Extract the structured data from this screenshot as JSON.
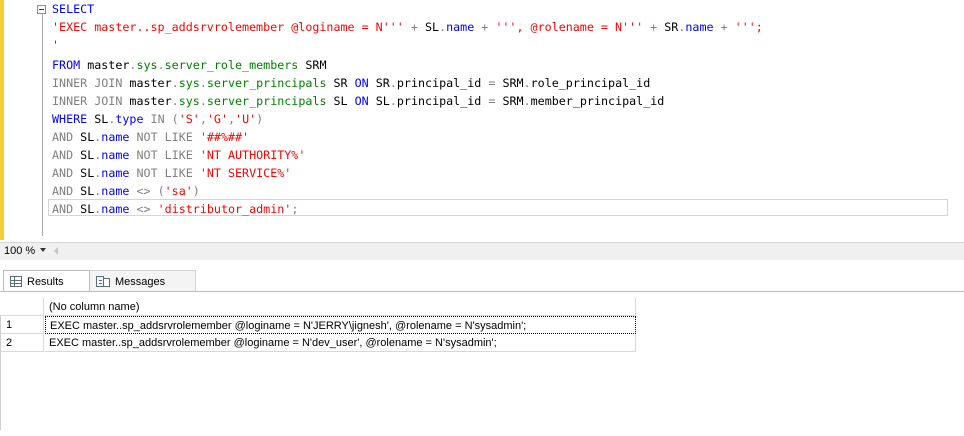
{
  "editor": {
    "lines": [
      [
        {
          "c": "kw",
          "t": "SELECT"
        }
      ],
      [
        {
          "c": "str",
          "t": "'EXEC master..sp_addsrvrolemember @loginame = N'''"
        },
        {
          "c": "op",
          "t": " + "
        },
        {
          "c": "txt",
          "t": "SL"
        },
        {
          "c": "op",
          "t": "."
        },
        {
          "c": "kw",
          "t": "name"
        },
        {
          "c": "op",
          "t": " + "
        },
        {
          "c": "str",
          "t": "''', @rolename = N'''"
        },
        {
          "c": "op",
          "t": " + "
        },
        {
          "c": "txt",
          "t": "SR"
        },
        {
          "c": "op",
          "t": "."
        },
        {
          "c": "kw",
          "t": "name"
        },
        {
          "c": "op",
          "t": " + "
        },
        {
          "c": "str",
          "t": "''';"
        }
      ],
      [
        {
          "c": "str",
          "t": "'"
        }
      ],
      [
        {
          "c": "kw",
          "t": "FROM"
        },
        {
          "c": "txt",
          "t": " master"
        },
        {
          "c": "op",
          "t": "."
        },
        {
          "c": "sys",
          "t": "sys"
        },
        {
          "c": "op",
          "t": "."
        },
        {
          "c": "sys",
          "t": "server_role_members"
        },
        {
          "c": "txt",
          "t": " SRM"
        }
      ],
      [
        {
          "c": "op",
          "t": "INNER JOIN"
        },
        {
          "c": "txt",
          "t": " master"
        },
        {
          "c": "op",
          "t": "."
        },
        {
          "c": "sys",
          "t": "sys"
        },
        {
          "c": "op",
          "t": "."
        },
        {
          "c": "sys",
          "t": "server_principals"
        },
        {
          "c": "txt",
          "t": " SR "
        },
        {
          "c": "kw",
          "t": "ON"
        },
        {
          "c": "txt",
          "t": " SR"
        },
        {
          "c": "op",
          "t": "."
        },
        {
          "c": "txt",
          "t": "principal_id "
        },
        {
          "c": "op",
          "t": "="
        },
        {
          "c": "txt",
          "t": " SRM"
        },
        {
          "c": "op",
          "t": "."
        },
        {
          "c": "txt",
          "t": "role_principal_id"
        }
      ],
      [
        {
          "c": "op",
          "t": "INNER JOIN"
        },
        {
          "c": "txt",
          "t": " master"
        },
        {
          "c": "op",
          "t": "."
        },
        {
          "c": "sys",
          "t": "sys"
        },
        {
          "c": "op",
          "t": "."
        },
        {
          "c": "sys",
          "t": "server_principals"
        },
        {
          "c": "txt",
          "t": " SL "
        },
        {
          "c": "kw",
          "t": "ON"
        },
        {
          "c": "txt",
          "t": " SL"
        },
        {
          "c": "op",
          "t": "."
        },
        {
          "c": "txt",
          "t": "principal_id "
        },
        {
          "c": "op",
          "t": "="
        },
        {
          "c": "txt",
          "t": " SRM"
        },
        {
          "c": "op",
          "t": "."
        },
        {
          "c": "txt",
          "t": "member_principal_id"
        }
      ],
      [
        {
          "c": "kw",
          "t": "WHERE"
        },
        {
          "c": "txt",
          "t": " SL"
        },
        {
          "c": "op",
          "t": "."
        },
        {
          "c": "kw",
          "t": "type"
        },
        {
          "c": "op",
          "t": " IN ("
        },
        {
          "c": "str",
          "t": "'S'"
        },
        {
          "c": "op",
          "t": ","
        },
        {
          "c": "str",
          "t": "'G'"
        },
        {
          "c": "op",
          "t": ","
        },
        {
          "c": "str",
          "t": "'U'"
        },
        {
          "c": "op",
          "t": ")"
        }
      ],
      [
        {
          "c": "op",
          "t": "AND"
        },
        {
          "c": "txt",
          "t": " SL"
        },
        {
          "c": "op",
          "t": "."
        },
        {
          "c": "kw",
          "t": "name"
        },
        {
          "c": "op",
          "t": " NOT LIKE "
        },
        {
          "c": "str",
          "t": "'##%##'"
        }
      ],
      [
        {
          "c": "op",
          "t": "AND"
        },
        {
          "c": "txt",
          "t": " SL"
        },
        {
          "c": "op",
          "t": "."
        },
        {
          "c": "kw",
          "t": "name"
        },
        {
          "c": "op",
          "t": " NOT LIKE "
        },
        {
          "c": "str",
          "t": "'NT AUTHORITY%'"
        }
      ],
      [
        {
          "c": "op",
          "t": "AND"
        },
        {
          "c": "txt",
          "t": " SL"
        },
        {
          "c": "op",
          "t": "."
        },
        {
          "c": "kw",
          "t": "name"
        },
        {
          "c": "op",
          "t": " NOT LIKE "
        },
        {
          "c": "str",
          "t": "'NT SERVICE%'"
        }
      ],
      [
        {
          "c": "op",
          "t": "AND"
        },
        {
          "c": "txt",
          "t": " SL"
        },
        {
          "c": "op",
          "t": "."
        },
        {
          "c": "kw",
          "t": "name"
        },
        {
          "c": "op",
          "t": " <> ("
        },
        {
          "c": "str",
          "t": "'sa'"
        },
        {
          "c": "op",
          "t": ")"
        }
      ],
      [
        {
          "c": "op",
          "t": "AND"
        },
        {
          "c": "txt",
          "t": " SL"
        },
        {
          "c": "op",
          "t": "."
        },
        {
          "c": "kw",
          "t": "name"
        },
        {
          "c": "op",
          "t": " <> "
        },
        {
          "c": "str",
          "t": "'distributor_admin'"
        },
        {
          "c": "op",
          "t": ";"
        }
      ]
    ]
  },
  "zoom": {
    "label": "100 %"
  },
  "tabs": {
    "results": "Results",
    "messages": "Messages"
  },
  "grid": {
    "column_header": "(No column name)",
    "rows": [
      {
        "num": "1",
        "value": "EXEC master..sp_addsrvrolemember @loginame = N'JERRY\\jignesh', @rolename = N'sysadmin';"
      },
      {
        "num": "2",
        "value": "EXEC master..sp_addsrvrolemember @loginame = N'dev_user', @rolename = N'sysadmin';"
      }
    ]
  },
  "colors": {
    "keyword": "#0000ff",
    "string": "#ff0000",
    "operator": "#808080",
    "system_object": "#008000",
    "change_bar": "#f2cf39"
  }
}
